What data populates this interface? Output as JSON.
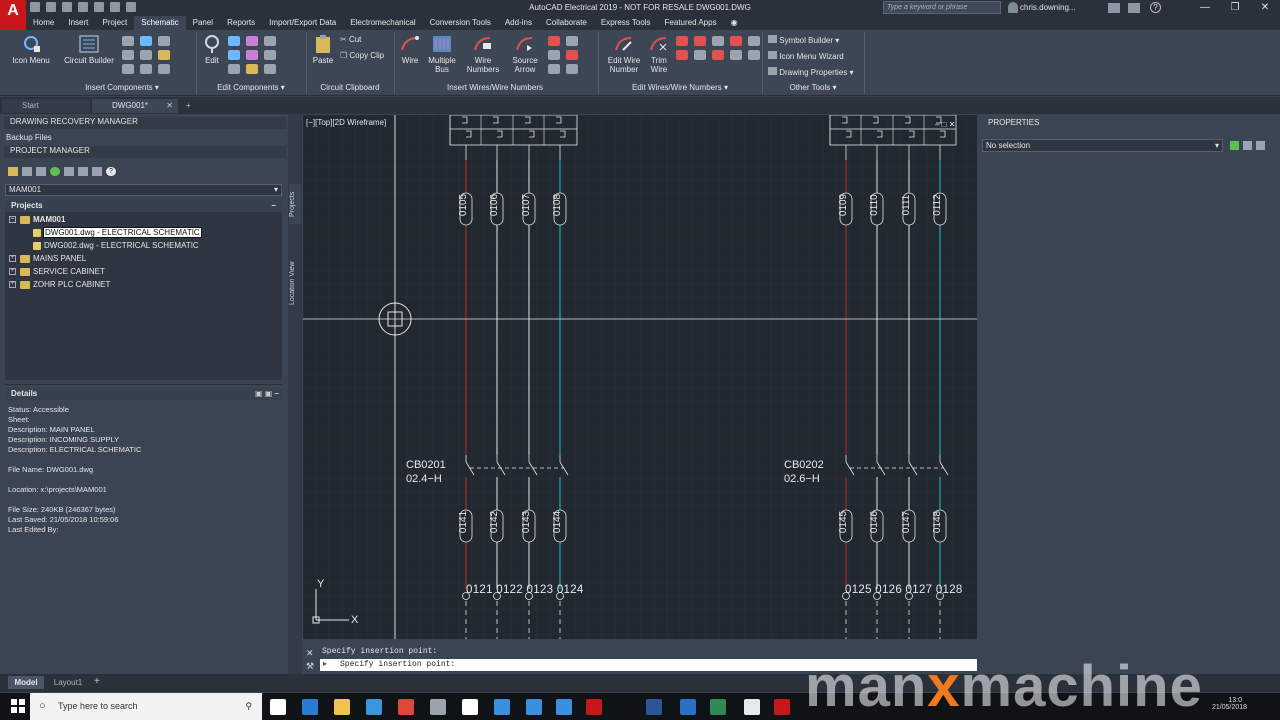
{
  "titlebar": {
    "title": "AutoCAD Electrical 2019 - NOT FOR RESALE    DWG001.DWG",
    "search_placeholder": "Type a keyword or phrase",
    "user": "chris.downing..."
  },
  "menu_tabs": [
    "Home",
    "Insert",
    "Project",
    "Schematic",
    "Panel",
    "Reports",
    "Import/Export Data",
    "Electromechanical",
    "Conversion Tools",
    "Add-ins",
    "Collaborate",
    "Express Tools",
    "Featured Apps"
  ],
  "active_tab": "Schematic",
  "ribbon": {
    "icon_menu": "Icon Menu",
    "circuit_builder": "Circuit Builder",
    "group_insert_components": "Insert Components",
    "edit": "Edit",
    "group_edit_components": "Edit Components",
    "paste": "Paste",
    "cut": "Cut",
    "copy_clip": "Copy Clip",
    "group_circuit_clipboard": "Circuit Clipboard",
    "wire": "Wire",
    "multiple_bus_1": "Multiple",
    "multiple_bus_2": "Bus",
    "wire_numbers_1": "Wire",
    "wire_numbers_2": "Numbers",
    "source_arrow_1": "Source",
    "source_arrow_2": "Arrow",
    "group_insert_wires": "Insert Wires/Wire Numbers",
    "edit_wire_number_1": "Edit Wire",
    "edit_wire_number_2": "Number",
    "trim_wire_1": "Trim",
    "trim_wire_2": "Wire",
    "group_edit_wires": "Edit Wires/Wire Numbers",
    "symbol_builder": "Symbol Builder",
    "icon_menu_wizard": "Icon Menu  Wizard",
    "drawing_properties": "Drawing  Properties",
    "group_other_tools": "Other Tools"
  },
  "file_tabs": {
    "start": "Start",
    "current": "DWG001*"
  },
  "left_panel": {
    "recovery_manager": "DRAWING RECOVERY MANAGER",
    "backup_files": "Backup Files",
    "project_manager": "PROJECT MANAGER",
    "project_select": "MAM001",
    "projects_header": "Projects",
    "tree": [
      {
        "label": "MAM001",
        "level": 0,
        "bold": true
      },
      {
        "label": "DWG001.dwg - ELECTRICAL SCHEMATIC",
        "level": 1,
        "selected": true
      },
      {
        "label": "DWG002.dwg - ELECTRICAL SCHEMATIC",
        "level": 1
      },
      {
        "label": "MAINS PANEL",
        "level": 0
      },
      {
        "label": "SERVICE CABINET",
        "level": 0
      },
      {
        "label": "ZOHR PLC CABINET",
        "level": 0
      }
    ],
    "side_tabs": {
      "projects": "Projects",
      "location": "Location View"
    },
    "details_header": "Details",
    "details": [
      "Status: Accessible",
      "Sheet:",
      "Description: MAIN PANEL",
      "Description: INCOMING SUPPLY",
      "Description: ELECTRICAL SCHEMATIC",
      "",
      "File Name: DWG001.dwg",
      "",
      "Location: x:\\projects\\MAM001",
      "",
      "File Size: 240KB (246367 bytes)",
      "Last Saved: 21/05/2018 10:59:06",
      "Last Edited By:"
    ]
  },
  "drawing": {
    "viewport_label": "[−][Top][2D Wireframe]",
    "wire_tags_top": [
      "0105",
      "0106",
      "0107",
      "0108",
      "0109",
      "0110",
      "0111",
      "0112"
    ],
    "wire_tags_bottom": [
      "0141",
      "0142",
      "0143",
      "0144",
      "0145",
      "0146",
      "0147",
      "0148"
    ],
    "terminals_left": "0121 0122 0123 0124",
    "terminals_right": "0125 0126 0127 0128",
    "cb1_tag": "CB0201",
    "cb1_ref": "02.4−H",
    "cb2_tag": "CB0202",
    "cb2_ref": "02.6−H",
    "ucs_y": "Y",
    "ucs_x": "X",
    "colors": {
      "background": "#212830",
      "red_wire": "#c0282d",
      "cyan_wire": "#1fc6c6",
      "white_wire": "#e8e8e8"
    }
  },
  "command": {
    "history": "Specify insertion point:",
    "prompt": "Specify insertion point:"
  },
  "properties": {
    "title": "PROPERTIES",
    "selection": "No selection"
  },
  "model_tabs": {
    "model": "Model",
    "layout": "Layout1"
  },
  "taskbar": {
    "search": "Type here to search",
    "time": "13:0",
    "date": "21/05/2018"
  },
  "watermark": {
    "part1": "man",
    "part2": "x",
    "part3": "machine"
  }
}
